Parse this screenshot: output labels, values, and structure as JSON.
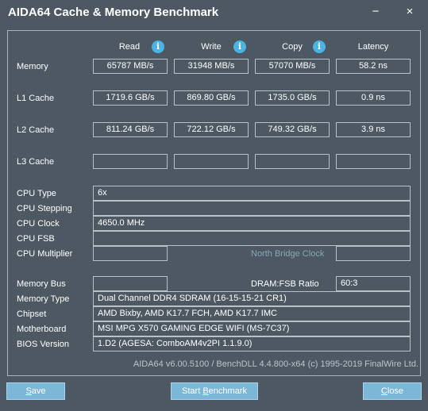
{
  "window": {
    "title": "AIDA64 Cache & Memory Benchmark",
    "minimize_glyph": "−",
    "close_glyph": "×"
  },
  "columns": {
    "read": "Read",
    "write": "Write",
    "copy": "Copy",
    "latency": "Latency"
  },
  "info_icon_glyph": "i",
  "rows": {
    "memory": {
      "label": "Memory",
      "read": "65787 MB/s",
      "write": "31948 MB/s",
      "copy": "57070 MB/s",
      "latency": "58.2 ns"
    },
    "l1": {
      "label": "L1 Cache",
      "read": "1719.6 GB/s",
      "write": "869.80 GB/s",
      "copy": "1735.0 GB/s",
      "latency": "0.9 ns"
    },
    "l2": {
      "label": "L2 Cache",
      "read": "811.24 GB/s",
      "write": "722.12 GB/s",
      "copy": "749.32 GB/s",
      "latency": "3.9 ns"
    },
    "l3": {
      "label": "L3 Cache",
      "read": "",
      "write": "",
      "copy": "",
      "latency": ""
    }
  },
  "cpu": {
    "type_label": "CPU Type",
    "type_value": "6x",
    "stepping_label": "CPU Stepping",
    "stepping_value": "",
    "clock_label": "CPU Clock",
    "clock_value": "4650.0 MHz",
    "fsb_label": "CPU FSB",
    "fsb_value": "",
    "multiplier_label": "CPU Multiplier",
    "multiplier_value": "",
    "north_bridge_clock_label": "North Bridge Clock",
    "north_bridge_clock_value": ""
  },
  "system": {
    "memory_bus_label": "Memory Bus",
    "memory_bus_value": "",
    "dram_fsb_label": "DRAM:FSB Ratio",
    "dram_fsb_value": "60:3",
    "memory_type_label": "Memory Type",
    "memory_type_value": "Dual Channel DDR4 SDRAM  (16-15-15-21 CR1)",
    "chipset_label": "Chipset",
    "chipset_value": "AMD Bixby, AMD K17.7 FCH, AMD K17.7 IMC",
    "motherboard_label": "Motherboard",
    "motherboard_value": "MSI MPG X570 GAMING EDGE WIFI (MS-7C37)",
    "bios_label": "BIOS Version",
    "bios_value": "1.D2  (AGESA: ComboAM4v2PI 1.1.9.0)"
  },
  "footer_text": "AIDA64 v6.00.5100 / BenchDLL 4.4.800-x64  (c) 1995-2019 FinalWire Ltd.",
  "buttons": {
    "save_mnemonic": "S",
    "save_rest": "ave",
    "start_prefix": "Start ",
    "start_mnemonic": "B",
    "start_rest": "enchmark",
    "close_mnemonic": "C",
    "close_rest": "lose"
  },
  "colors": {
    "background": "#4d5863",
    "button": "#7db7d8",
    "info_icon": "#4ab4e4",
    "north_bridge_text": "#86a9bd"
  }
}
